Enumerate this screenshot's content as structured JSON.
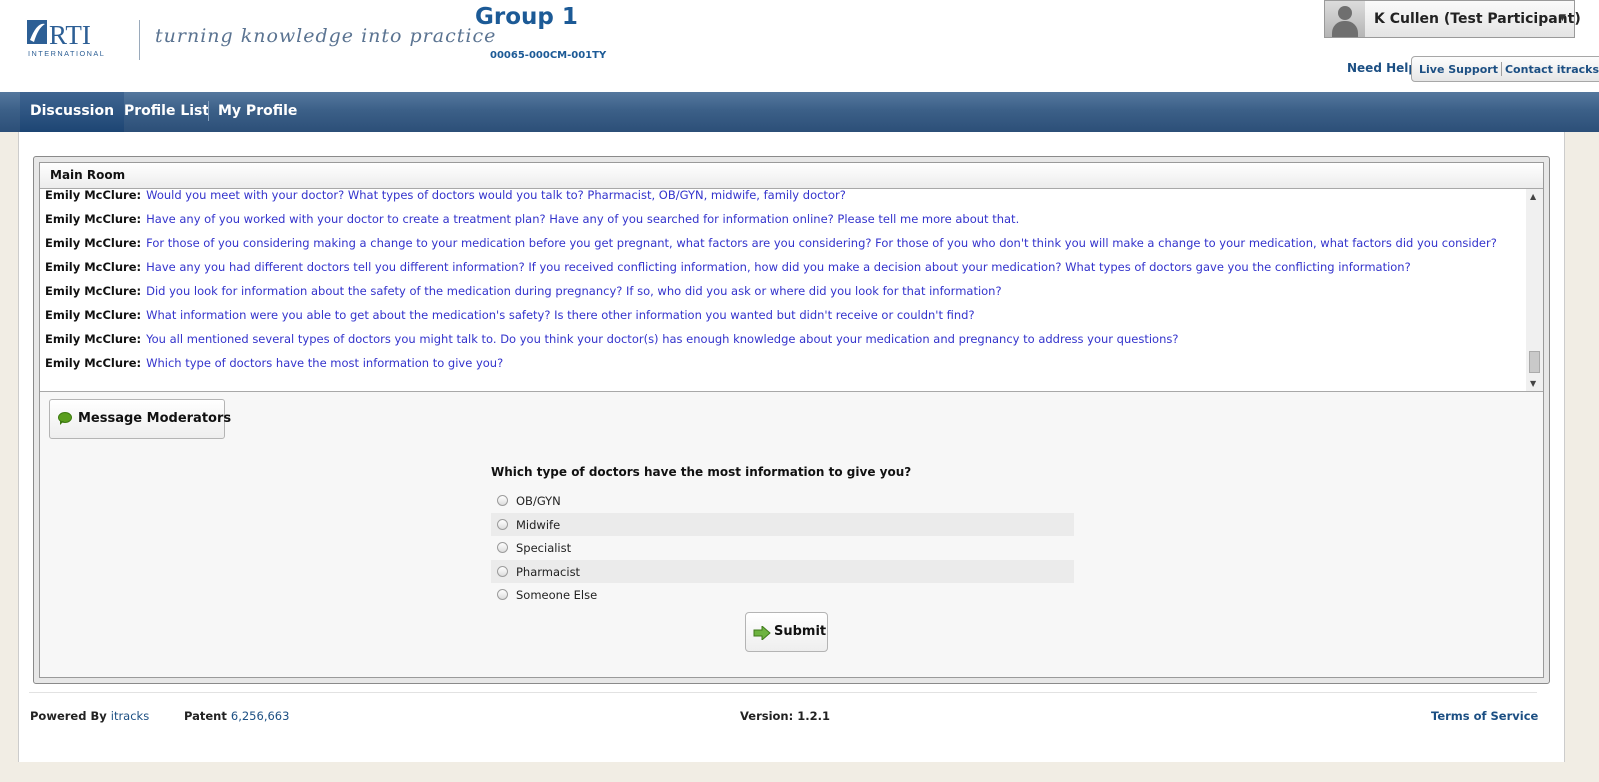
{
  "header": {
    "logo_text": "RTI",
    "logo_subtext": "INTERNATIONAL",
    "tagline": "turning knowledge into practice",
    "group_title": "Group 1",
    "group_code": "00065-000CM-001TY",
    "user_name": "K Cullen (Test Participant)",
    "need_help": "Need Help?",
    "live_support": "Live Support",
    "contact": "Contact itracks"
  },
  "nav": {
    "tabs": [
      {
        "label": "Discussion",
        "active": true
      },
      {
        "label": "Profile List",
        "active": false
      },
      {
        "label": "My Profile",
        "active": false
      }
    ]
  },
  "room": {
    "title": "Main Room",
    "messages": [
      {
        "sender": "Emily McClure:",
        "text": "Would you meet with your doctor? What types of doctors would you talk to? Pharmacist, OB/GYN, midwife, family doctor?"
      },
      {
        "sender": "Emily McClure:",
        "text": "Have any of you worked with your doctor to create a treatment plan? Have any of you searched for information online? Please tell me more about that."
      },
      {
        "sender": "Emily McClure:",
        "text": "For those of you considering making a change to your medication before you get pregnant, what factors are you considering? For those of you who don't think you will make a change to your medication, what factors did you consider?"
      },
      {
        "sender": "Emily McClure:",
        "text": "Have any you had different doctors tell you different information? If you received conflicting information, how did you make a decision about your medication? What types of doctors gave you the conflicting information?"
      },
      {
        "sender": "Emily McClure:",
        "text": "Did you look for information about the safety of the medication during pregnancy? If so, who did you ask or where did you look for that information?"
      },
      {
        "sender": "Emily McClure:",
        "text": "What information were you able to get about the medication's safety? Is there other information you wanted but didn't receive or couldn't find?"
      },
      {
        "sender": "Emily McClure:",
        "text": "You all mentioned several types of doctors you might talk to. Do you think your doctor(s) has enough knowledge about your medication and pregnancy to address your questions?"
      },
      {
        "sender": "Emily McClure:",
        "text": "Which type of doctors have the most information to give you?"
      }
    ],
    "message_moderators": "Message Moderators",
    "question": "Which type of doctors have the most information to give you?",
    "options": [
      "OB/GYN",
      "Midwife",
      "Specialist",
      "Pharmacist",
      "Someone Else"
    ],
    "submit": "Submit"
  },
  "footer": {
    "powered_by": "Powered By",
    "powered_link": "itracks",
    "patent_label": "Patent",
    "patent_number": "6,256,663",
    "version": "Version: 1.2.1",
    "terms": "Terms of Service"
  },
  "colors": {
    "brand_blue": "#1c5a96",
    "nav_bar": "#3c6088",
    "message_text": "#3333cc"
  }
}
